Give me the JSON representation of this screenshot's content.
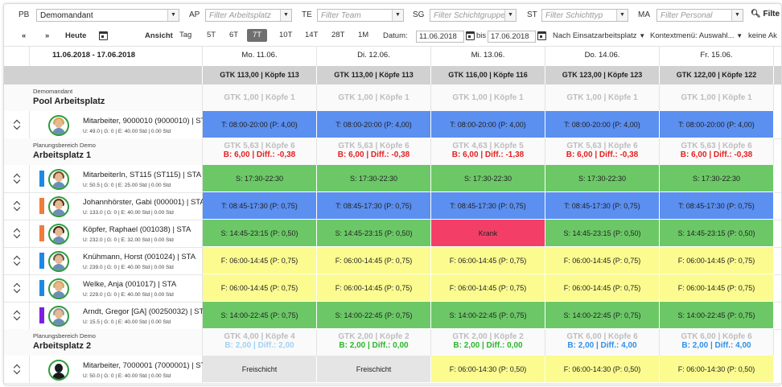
{
  "filters": {
    "pb_label": "PB",
    "pb_value": "Demomandant",
    "ap_label": "AP",
    "ap_placeholder": "Filter Arbeitsplatz",
    "te_label": "TE",
    "te_placeholder": "Filter Team",
    "sg_label": "SG",
    "sg_placeholder": "Filter Schichtgruppe",
    "st_label": "ST",
    "st_placeholder": "Filter Schichttyp",
    "ma_label": "MA",
    "ma_placeholder": "Filter Personal",
    "filter_button": "Filte"
  },
  "toolbar": {
    "prev": "«",
    "next": "»",
    "today": "Heute",
    "view_label": "Ansicht",
    "views": [
      "Tag",
      "5T",
      "6T",
      "7T",
      "10T",
      "14T",
      "28T",
      "1M"
    ],
    "active_view": "7T",
    "date_label": "Datum:",
    "date_from": "11.06.2018",
    "bis": "bis",
    "date_to": "17.06.2018",
    "group_select": "Nach Einsatzarbeitsplatz",
    "context_menu": "Kontextmenü: Auswahl...",
    "extra": "keine Ak"
  },
  "grid": {
    "range": "11.06.2018 - 17.06.2018",
    "days": [
      "Mo. 11.06.",
      "Di. 12.06.",
      "Mi. 13.06.",
      "Do. 14.06.",
      "Fr. 15.06."
    ],
    "gtk": [
      "GTK 113,00 | Köpfe 113",
      "GTK 113,00 | Köpfe 113",
      "GTK 116,00 | Köpfe 116",
      "GTK 123,00 | Köpfe 123",
      "GTK 122,00 | Köpfe 122"
    ],
    "sections": [
      {
        "label": "Demomandant",
        "title": "Pool Arbeitsplatz",
        "stats1": [
          "GTK 1,00 | Köpfe 1",
          "GTK 1,00 | Köpfe 1",
          "GTK 1,00 | Köpfe 1",
          "GTK 1,00 | Köpfe 1",
          "GTK 1,00 | Köpfe 1"
        ],
        "stats2": [
          "",
          "",
          "",
          "",
          ""
        ],
        "stats2_colors": [
          "#e52020",
          "#e52020",
          "#e52020",
          "#e52020",
          "#e52020"
        ],
        "employees": [
          {
            "name": "Mitarbeiter, 9000010 (9000010) | STA",
            "sub": "U: 49.0 | G: 0 | E: 40.00 Std | 0.00 Std",
            "bar": "",
            "avatar": "woman-blonde",
            "shifts": [
              {
                "t": "T: 08:00-20:00 (P: 4,00)",
                "c": "blue"
              },
              {
                "t": "T: 08:00-20:00 (P: 4,00)",
                "c": "blue"
              },
              {
                "t": "T: 08:00-20:00 (P: 4,00)",
                "c": "blue"
              },
              {
                "t": "T: 08:00-20:00 (P: 4,00)",
                "c": "blue"
              },
              {
                "t": "T: 08:00-20:00 (P: 4,00)",
                "c": "blue"
              }
            ]
          }
        ]
      },
      {
        "label": "Planungsbereich Demo",
        "title": "Arbeitsplatz 1",
        "stats1": [
          "GTK 5,63 | Köpfe 6",
          "GTK 5,63 | Köpfe 6",
          "GTK 4,63 | Köpfe 5",
          "GTK 5,63 | Köpfe 6",
          "GTK 5,63 | Köpfe 6"
        ],
        "stats2": [
          "B: 6,00 | Diff.: -0,38",
          "B: 6,00 | Diff.: -0,38",
          "B: 6,00 | Diff.: -1,38",
          "B: 6,00 | Diff.: -0,38",
          "B: 6,00 | Diff.: -0,38"
        ],
        "stats2_colors": [
          "#e52020",
          "#e52020",
          "#e52020",
          "#e52020",
          "#e52020"
        ],
        "employees": [
          {
            "name": "MitarbeiterIn, ST115 (ST115) | STA",
            "sub": "U: 50.5 | G: 0 | E: 25.00 Std | 0.00 Std",
            "bar": "#1e88e5",
            "avatar": "woman-brown",
            "shifts": [
              {
                "t": "S: 17:30-22:30",
                "c": "green"
              },
              {
                "t": "S: 17:30-22:30",
                "c": "green"
              },
              {
                "t": "S: 17:30-22:30",
                "c": "green"
              },
              {
                "t": "S: 17:30-22:30",
                "c": "green"
              },
              {
                "t": "S: 17:30-22:30",
                "c": "green"
              }
            ]
          },
          {
            "name": "Johannhörster, Gabi (000001) | STA",
            "sub": "U: 133.0 | G: 0 | E: 40.00 Std | 0.00 Std",
            "bar": "#ef7c3a",
            "avatar": "woman-dark",
            "shifts": [
              {
                "t": "T: 08:45-17:30 (P: 0,75)",
                "c": "blue"
              },
              {
                "t": "T: 08:45-17:30 (P: 0,75)",
                "c": "blue"
              },
              {
                "t": "T: 08:45-17:30 (P: 0,75)",
                "c": "blue"
              },
              {
                "t": "T: 08:45-17:30 (P: 0,75)",
                "c": "blue"
              },
              {
                "t": "T: 08:45-17:30 (P: 0,75)",
                "c": "blue"
              }
            ]
          },
          {
            "name": "Köpfer, Raphael (001038) | STA",
            "sub": "U: 232.0 | G: 0 | E: 32.00 Std | 0.00 Std",
            "bar": "#ef7c3a",
            "avatar": "man",
            "shifts": [
              {
                "t": "S: 14:45-23:15 (P: 0,50)",
                "c": "green"
              },
              {
                "t": "S: 14:45-23:15 (P: 0,50)",
                "c": "green"
              },
              {
                "t": "Krank",
                "c": "red"
              },
              {
                "t": "S: 14:45-23:15 (P: 0,50)",
                "c": "green"
              },
              {
                "t": "S: 14:45-23:15 (P: 0,50)",
                "c": "green"
              }
            ]
          },
          {
            "name": "Knühmann, Horst (001024) | STA",
            "sub": "U: 239.0 | G: 0 | E: 40.00 Std | 0.00 Std",
            "bar": "#1e88e5",
            "avatar": "man2",
            "shifts": [
              {
                "t": "F: 06:00-14:45 (P: 0,75)",
                "c": "yellow"
              },
              {
                "t": "F: 06:00-14:45 (P: 0,75)",
                "c": "yellow"
              },
              {
                "t": "F: 06:00-14:45 (P: 0,75)",
                "c": "yellow"
              },
              {
                "t": "F: 06:00-14:45 (P: 0,75)",
                "c": "yellow"
              },
              {
                "t": "F: 06:00-14:45 (P: 0,75)",
                "c": "yellow"
              }
            ]
          },
          {
            "name": "Welke, Anja (001017) | STA",
            "sub": "U: 229.0 | G: 0 | E: 40.00 Std | 0.00 Std",
            "bar": "#1e88e5",
            "avatar": "woman-blonde",
            "shifts": [
              {
                "t": "F: 06:00-14:45 (P: 0,75)",
                "c": "yellow"
              },
              {
                "t": "F: 06:00-14:45 (P: 0,75)",
                "c": "yellow"
              },
              {
                "t": "F: 06:00-14:45 (P: 0,75)",
                "c": "yellow"
              },
              {
                "t": "F: 06:00-14:45 (P: 0,75)",
                "c": "yellow"
              },
              {
                "t": "F: 06:00-14:45 (P: 0,75)",
                "c": "yellow"
              }
            ]
          },
          {
            "name": "Arndt, Gregor [GA] (00250032) | STA",
            "sub": "U: 15.5 | G: 0 | E: 40.00 Std | 0.00 Std",
            "bar": "#7b1fe0",
            "avatar": "man3",
            "shifts": [
              {
                "t": "S: 14:00-22:45 (P: 0,75)",
                "c": "green"
              },
              {
                "t": "S: 14:00-22:45 (P: 0,75)",
                "c": "green"
              },
              {
                "t": "S: 14:00-22:45 (P: 0,75)",
                "c": "green"
              },
              {
                "t": "S: 14:00-22:45 (P: 0,75)",
                "c": "green"
              },
              {
                "t": "S: 14:00-22:45 (P: 0,75)",
                "c": "green"
              }
            ]
          }
        ]
      },
      {
        "label": "Planungsbereich Demo",
        "title": "Arbeitsplatz 2",
        "stats1": [
          "GTK 4,00 | Köpfe 4",
          "GTK 2,00 | Köpfe 2",
          "GTK 2,00 | Köpfe 2",
          "GTK 6,00 | Köpfe 6",
          "GTK 6,00 | Köpfe 6"
        ],
        "stats2": [
          "B: 2,00 | Diff.: 2,00",
          "B: 2,00 | Diff.: 0,00",
          "B: 2,00 | Diff.: 0,00",
          "B: 2,00 | Diff.: 4,00",
          "B: 2,00 | Diff.: 4,00"
        ],
        "stats2_colors": [
          "#9fd2f5",
          "#2bb52b",
          "#2bb52b",
          "#2f8fe8",
          "#2f8fe8"
        ],
        "employees": [
          {
            "name": "Mitarbeiter, 7000001 (7000001) | STA",
            "sub": "U: 50.0 | G: 0 | E: 40.00 Std | 0.00 Std",
            "bar": "",
            "avatar": "blank",
            "shifts": [
              {
                "t": "Freischicht",
                "c": "grey"
              },
              {
                "t": "Freischicht",
                "c": "grey"
              },
              {
                "t": "F: 06:00-14:30 (P: 0,50)",
                "c": "yellow"
              },
              {
                "t": "F: 06:00-14:30 (P: 0,50)",
                "c": "yellow"
              },
              {
                "t": "F: 06:00-14:30 (P: 0,50)",
                "c": "yellow"
              }
            ]
          }
        ]
      }
    ]
  }
}
